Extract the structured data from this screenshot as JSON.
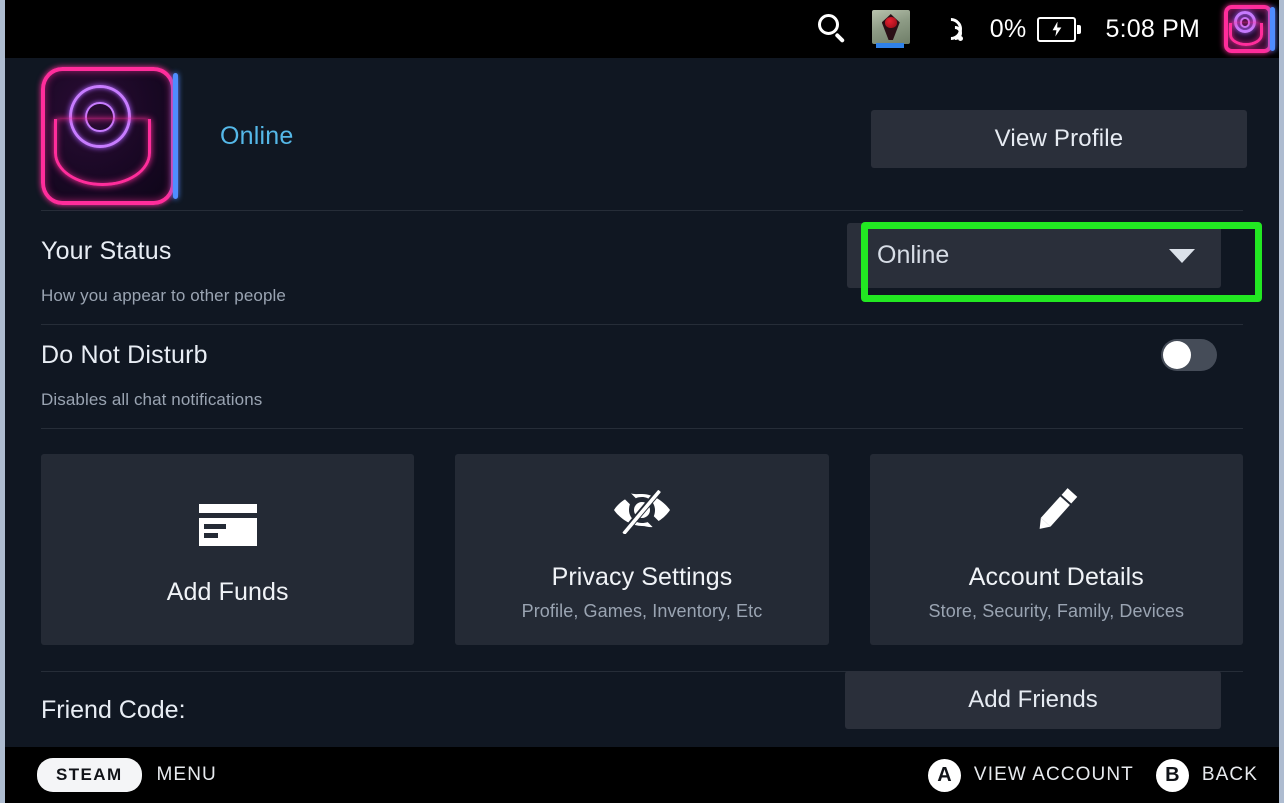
{
  "statusbar": {
    "search_icon": "search-icon",
    "app_icon": "app-icon",
    "wifi_icon": "wifi-signal-icon",
    "battery_percent": "0%",
    "battery_icon": "battery-charging-icon",
    "time": "5:08 PM",
    "avatar_icon": "user-avatar-icon"
  },
  "profile": {
    "avatar_icon": "user-avatar-icon",
    "online_label": "Online",
    "view_profile_label": "View Profile"
  },
  "status_row": {
    "title": "Your Status",
    "subtitle": "How you appear to other people",
    "selected_value": "Online",
    "caret_icon": "chevron-down-icon",
    "highlight_color": "#22e822"
  },
  "dnd_row": {
    "title": "Do Not Disturb",
    "subtitle": "Disables all chat notifications",
    "toggle_state": "off"
  },
  "cards": [
    {
      "label": "Add Funds",
      "sublabel": "",
      "icon": "credit-card-icon"
    },
    {
      "label": "Privacy Settings",
      "sublabel": "Profile, Games, Inventory, Etc",
      "icon": "eye-off-icon"
    },
    {
      "label": "Account Details",
      "sublabel": "Store, Security, Family, Devices",
      "icon": "pencil-icon"
    }
  ],
  "friend_row": {
    "label": "Friend Code:",
    "add_friends_label": "Add Friends"
  },
  "bottombar": {
    "steam_pill": "STEAM",
    "menu_label": "MENU",
    "actions": [
      {
        "button": "A",
        "label": "VIEW ACCOUNT"
      },
      {
        "button": "B",
        "label": "BACK"
      }
    ]
  },
  "colors": {
    "background": "#101722",
    "card": "#242a35",
    "control": "#2a2f3a",
    "accent_online": "#55b8e8",
    "highlight": "#22e822"
  }
}
